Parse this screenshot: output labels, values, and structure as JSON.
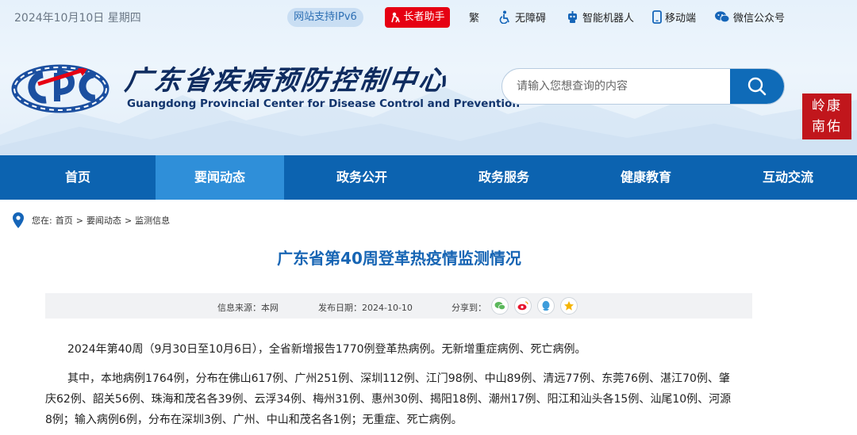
{
  "topbar": {
    "date": "2024年10月10日 星期四",
    "ipv6": "网站支持IPv6",
    "elder": "长者助手",
    "traditional": "繁",
    "accessibility": "无障碍",
    "robot": "智能机器人",
    "mobile": "移动端",
    "wechat": "微信公众号"
  },
  "brand": {
    "cn_title": "广东省疾病预防控制中心",
    "en_title": "Guangdong Provincial Center for Disease Control and Prevention",
    "seal_line1": "康",
    "seal_line2": "岭",
    "seal_line3": "南",
    "seal_line4": "佑",
    "colors": {
      "primary": "#0c63b0",
      "active": "#2f8fd9",
      "red": "#e60012",
      "title": "#1765b4"
    }
  },
  "search": {
    "placeholder": "请输入您想查询的内容"
  },
  "nav": {
    "items": [
      "首页",
      "要闻动态",
      "政务公开",
      "政务服务",
      "健康教育",
      "互动交流"
    ],
    "active_index": 1
  },
  "breadcrumb": {
    "prefix": "您在:",
    "items": [
      "首页",
      "要闻动态",
      "监测信息"
    ],
    "sep": ">"
  },
  "article": {
    "title": "广东省第40周登革热疫情监测情况",
    "source": "信息来源：本网",
    "date": "发布日期：2024-10-10",
    "share_label": "分享到：",
    "share_icons": [
      "wechat-icon",
      "weibo-icon",
      "qq-icon",
      "qzone-icon"
    ],
    "para1": "2024年第40周（9月30日至10月6日），全省新增报告1770例登革热病例。无新增重症病例、死亡病例。",
    "para2_line1": "其中，本地病例1764例，分布在佛山617例、广州251例、深圳112例、江门98例、中山89例、清远77例、东莞76例、湛江70例、肇",
    "para2_line2": "庆62例、韶关56例、珠海和茂名各39例、云浮34例、梅州31例、惠州30例、揭阳18例、潮州17例、阳江和汕头各15例、汕尾10例、河源",
    "para2_line3": "8例；输入病例6例，分布在深圳3例、广州、中山和茂名各1例；无重症、死亡病例。"
  }
}
